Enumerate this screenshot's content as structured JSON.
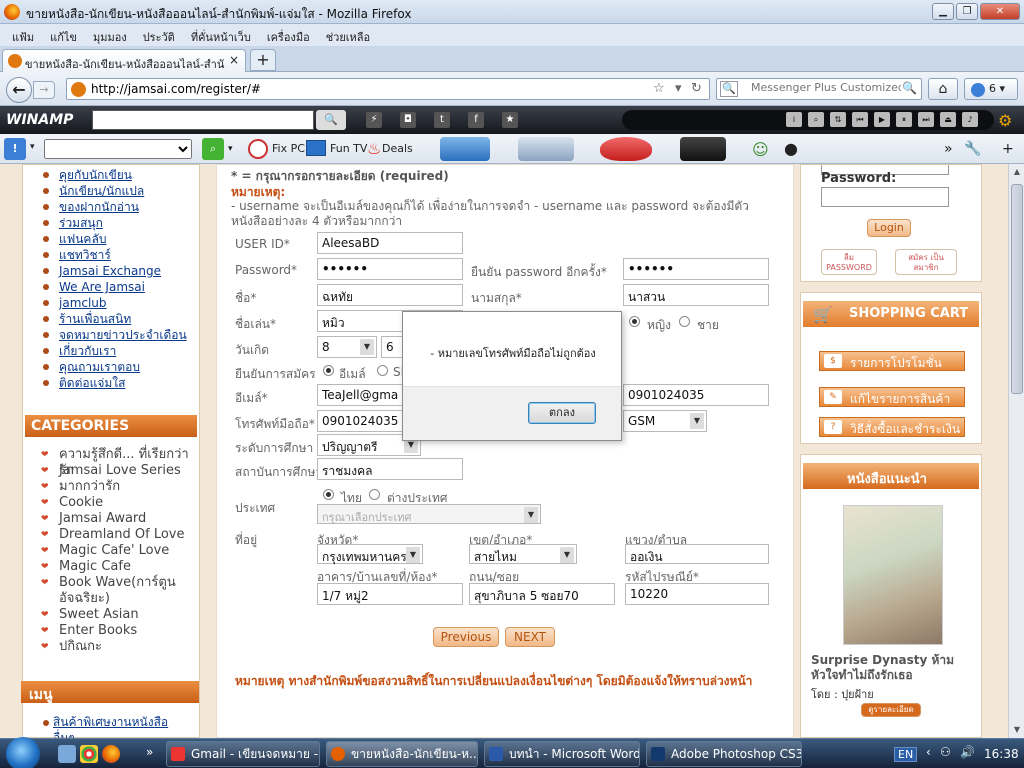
{
  "window": {
    "title": "ขายหนังสือ-นักเขียน-หนังสือออนไลน์-สำนักพิมพ์-แจ่มใส - Mozilla Firefox"
  },
  "menu": [
    "แฟ้ม",
    "แก้ไข",
    "มุมมอง",
    "ประวัติ",
    "ที่คั่นหน้าเว็บ",
    "เครื่องมือ",
    "ช่วยเหลือ"
  ],
  "tab": {
    "title": "ขายหนังสือ-นักเขียน-หนังสือออนไลน์-สำนักพิ...",
    "close": "×",
    "new": "+"
  },
  "nav": {
    "url": "http://jamsai.com/register/#",
    "search_placeholder": "Messenger Plus Customized We",
    "msg_count": "6"
  },
  "winamp": {
    "logo": "WINAMP"
  },
  "toolbar2": {
    "fix_pc": "Fix PC",
    "fun_tv": "Fun TV",
    "deals": "Deals",
    "more": "»"
  },
  "leftnav": {
    "links": [
      "คุยกับนักเขียน",
      "นักเขียน/นักแปล",
      "ของฝากนักอ่าน",
      "ร่วมสนุก",
      "แฟนคลับ",
      "แชทวิชาร์",
      "Jamsai Exchange",
      "We Are Jamsai",
      "jamclub",
      "ร้านเพื่อนสนิท",
      "จดหมายข่าวประจำเดือน",
      "เกี่ยวกับเรา",
      "คุณถามเราตอบ",
      "ติดต่อแจ่มใส"
    ],
    "categories_title": "CATEGORIES",
    "categories": [
      "ความรู้สึกดี... ที่เรียกว่ารัก",
      "Jamsai Love Series",
      "มากกว่ารัก",
      "Cookie",
      "Jamsai Award",
      "Dreamland Of Love",
      "Magic Cafe' Love",
      "Magic Cafe",
      "Book Wave(การ์ตูนอัจฉริยะ)",
      "Sweet Asian",
      "Enter Books",
      "ปกิณกะ"
    ],
    "menu_title": "เมนู",
    "menu_items": [
      "สินค้าพิเศษงานหนังสือ",
      "อื่นๆ"
    ]
  },
  "form": {
    "required_note": "* = กรุณากรอกรายละเอียด (required)",
    "remark_title": "หมายเหตุ:",
    "remark_text": "- username จะเป็นอีเมล์ของคุณก็ได้ เพื่อง่ายในการจดจำ - username และ password จะต้องมีตัวหนังสืออย่างละ 4 ตัวหรือมากกว่า",
    "labels": {
      "user_id": "USER ID*",
      "password": "Password*",
      "confirm_password": "ยืนยัน password อีกครั้ง*",
      "first_name": "ชื่อ*",
      "last_name": "นามสกุล*",
      "nickname": "ชื่อเล่น*",
      "birthday": "วันเกิด",
      "confirm_signup": "ยืนยันการสมัคร",
      "email": "อีเมล์*",
      "mobile": "โทรศัพท์มือถือ*",
      "education": "ระดับการศึกษา",
      "school": "สถาบันการศึกษา",
      "country": "ประเทศ",
      "address": "ที่อยู่",
      "province": "จังหวัด*",
      "district": "เขต/อำเภอ*",
      "subdistrict": "แขวง/ตำบล",
      "building": "อาคาร/บ้านเลขที่/ห้อง*",
      "road": "ถนน/ซอย",
      "postcode": "รหัสไปรษณีย์*"
    },
    "values": {
      "user_id": "AleesaBD",
      "password": "••••••",
      "confirm_password": "••••••",
      "first_name": "ฉหทัย",
      "last_name": "นาสวน",
      "nickname": "หมิว",
      "birth_day": "8",
      "birth_month": "6",
      "email": "TeaJell@gma",
      "phone2": "0901024035",
      "mobile": "0901024035",
      "network": "GSM",
      "education": "ปริญญาตรี",
      "school": "ราชมงคล",
      "country_select": "กรุณาเลือกประเทศ",
      "province": "กรุงเทพมหานคร",
      "district": "สายไหม",
      "subdistrict": "ออเงิน",
      "building": "1/7 หมู่2",
      "road": "สุขาภิบาล 5 ซอย70",
      "postcode": "10220"
    },
    "radios": {
      "female": "หญิง",
      "male": "ชาย",
      "confirm_email": "อีเมล์",
      "confirm_sms": "SMS",
      "thai": "ไทย",
      "foreign": "ต่างประเทศ"
    },
    "prev_button": "Previous",
    "next_button": "NEXT",
    "footer_note": "หมายเหตุ  ทางสำนักพิมพ์ขอสงวนสิทธิ์ในการเปลี่ยนแปลงเงื่อนไขต่างๆ  โดยมิต้องแจ้งให้ทราบล่วงหน้า"
  },
  "login": {
    "password_label": "Password:",
    "login_button": "Login",
    "forgot": "ลืม PASSWORD",
    "signup": "สมัคร เป็นสมาชิก"
  },
  "cart": {
    "title": "SHOPPING CART",
    "buttons": [
      "รายการโปรโมชั่น",
      "แก้ไขรายการสินค้า",
      "วิธีสั่งซื้อและชำระเงิน"
    ]
  },
  "recommend": {
    "title": "หนังสือแนะนำ",
    "book_title": "Surprise Dynasty ห้ามหัวใจทำไม่ถึงรักเธอ",
    "author": "โดย : ปุยฝ้าย",
    "detail_button": "ดูรายละเอียด"
  },
  "dialog": {
    "message": "- หมายเลขโทรศัพท์มือถือไม่ถูกต้อง",
    "ok": "ตกลง"
  },
  "taskbar": {
    "tasks": [
      "Gmail - เขียนจดหมาย - ...",
      "ขายหนังสือ-นักเขียน-ห...",
      "บทนำ - Microsoft Word",
      "Adobe Photoshop CS3..."
    ],
    "lang": "EN",
    "time": "16:38"
  },
  "colors": {
    "accent_orange": "#e27d2e",
    "link_blue": "#0b3a8a",
    "page_bg": "#f3e7d7"
  }
}
